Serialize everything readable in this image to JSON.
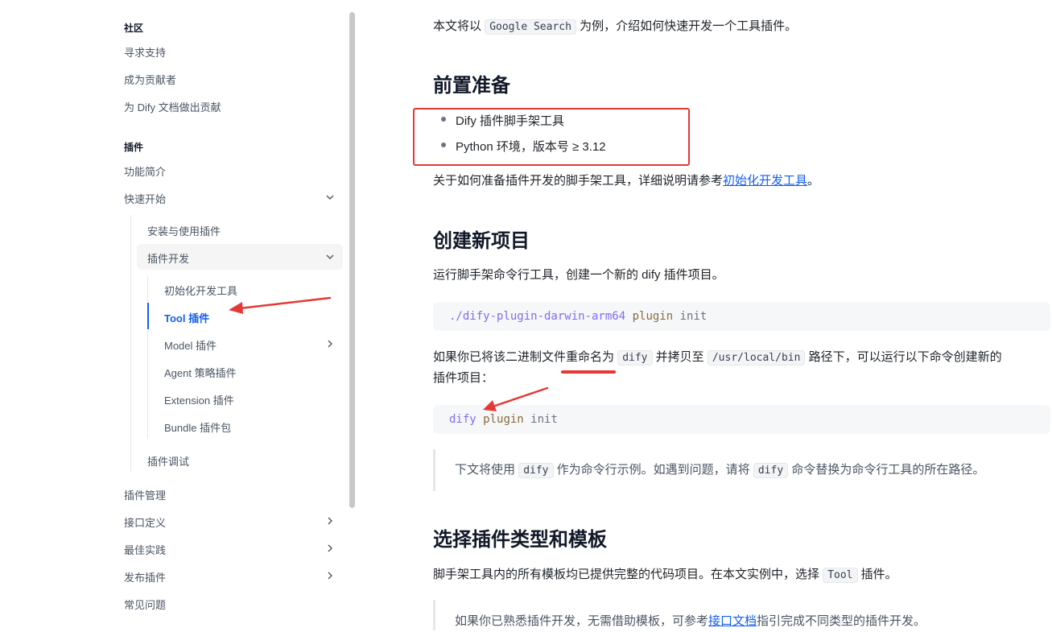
{
  "sidebar": {
    "community": {
      "title": "社区",
      "items": [
        "寻求支持",
        "成为贡献者",
        "为 Dify 文档做出贡献"
      ]
    },
    "plugins": {
      "title": "插件",
      "intro": "功能简介",
      "quickstart": "快速开始",
      "install": "安装与使用插件",
      "develop": "插件开发",
      "dev_items": [
        "初始化开发工具",
        "Tool 插件",
        "Model 插件",
        "Agent 策略插件",
        "Extension 插件",
        "Bundle 插件包"
      ],
      "debug": "插件调试",
      "manage": "插件管理",
      "api": "接口定义",
      "best": "最佳实践",
      "publish": "发布插件",
      "faq": "常见问题"
    }
  },
  "content": {
    "intro_pre": "本文将以",
    "intro_code": "Google Search",
    "intro_post": "为例，介绍如何快速开发一个工具插件。",
    "h_prep": "前置准备",
    "prep_items": [
      "Dify 插件脚手架工具",
      "Python 环境，版本号 ≥ 3.12"
    ],
    "prep_note_pre": "关于如何准备插件开发的脚手架工具，详细说明请参考",
    "prep_note_link": "初始化开发工具",
    "prep_note_post": "。",
    "h_create": "创建新项目",
    "create_desc": "运行脚手架命令行工具，创建一个新的 dify 插件项目。",
    "cmd1_path": "./dify-plugin-darwin-arm64",
    "cmd1_sub": "plugin",
    "cmd1_arg": "init",
    "rename_pre": "如果你已将该二进制文件重命名为",
    "rename_code1": "dify",
    "rename_mid": "并拷贝至",
    "rename_code2": "/usr/local/bin",
    "rename_post": "路径下，可以运行以下命令创建新的",
    "rename_line2": "插件项目：",
    "cmd2_bin": "dify",
    "cmd2_sub": "plugin",
    "cmd2_arg": "init",
    "quote1_pre": "下文将使用",
    "quote1_code1": "dify",
    "quote1_mid": "作为命令行示例。如遇到问题，请将",
    "quote1_code2": "dify",
    "quote1_post": "命令替换为命令行工具的所在路径。",
    "h_select": "选择插件类型和模板",
    "select_pre": "脚手架工具内的所有模板均已提供完整的代码项目。在本文实例中，选择",
    "select_code": "Tool",
    "select_post": "插件。",
    "quote2_pre": "如果你已熟悉插件开发，无需借助模板，可参考",
    "quote2_link": "接口文档",
    "quote2_post": "指引完成不同类型的插件开发。"
  },
  "colors": {
    "accent": "#155eef",
    "annotation": "#e53935"
  }
}
